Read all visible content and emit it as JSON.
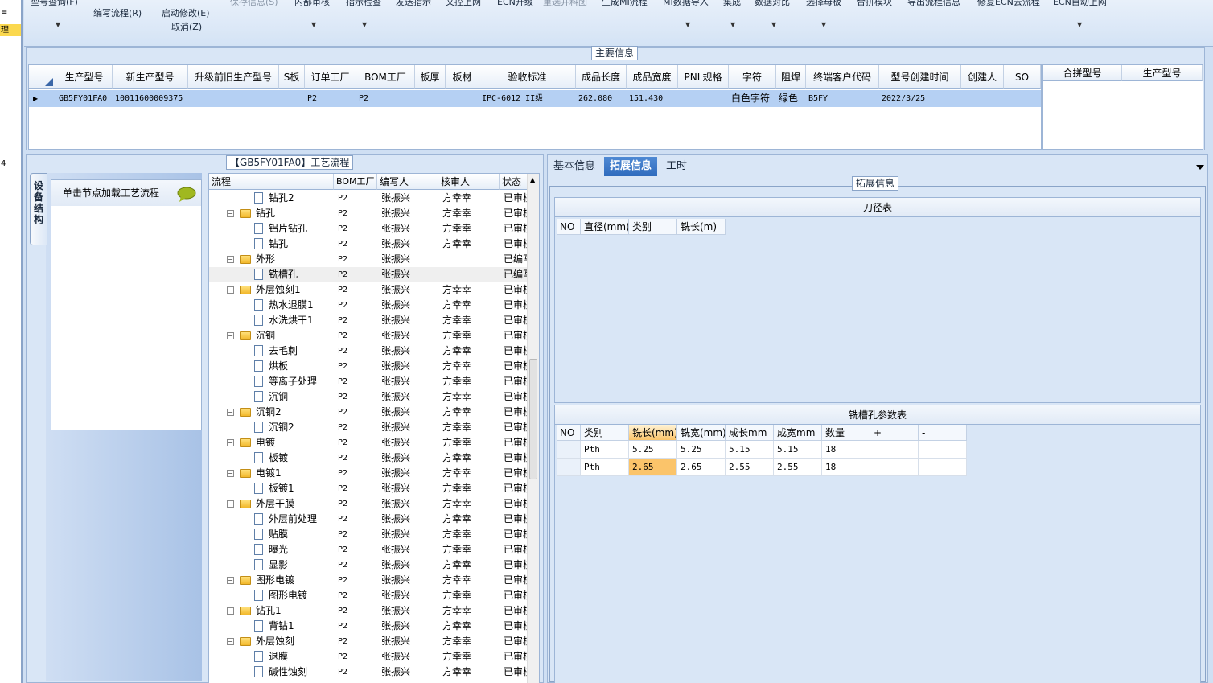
{
  "left_strip": {
    "items": [
      "≡",
      "理"
    ],
    "marker": "4"
  },
  "toolbar": {
    "row1": [
      "型号查询(F)",
      "保存信息(S)",
      "内部审核",
      "指示检查",
      "发送指示",
      "文控上网",
      "ECN升级",
      "重选并料图",
      "生成MI流程",
      "MI数据导入",
      "集成",
      "数据对比",
      "选择母板",
      "合拼模块",
      "导出流程信息",
      "修复ECN去流程",
      "ECN自动上网"
    ],
    "edit_flow": "编写流程(R)",
    "start_modify": "启动修改(E)",
    "cancel": "取消(Z)"
  },
  "main_info": {
    "title": "主要信息",
    "columns": [
      "生产型号",
      "新生产型号",
      "升级前旧生产型号",
      "S板",
      "订单工厂",
      "BOM工厂",
      "板厚",
      "板材",
      "验收标准",
      "成品长度",
      "成品宽度",
      "PNL规格",
      "字符",
      "阻焊",
      "终端客户代码",
      "型号创建时间",
      "创建人",
      "SO"
    ],
    "row": [
      "GB5FY01FA0",
      "10011600009375",
      "",
      "",
      "P2",
      "P2",
      "",
      "",
      "IPC-6012 II级",
      "262.080",
      "151.430",
      "",
      "白色字符",
      "绿色",
      "B5FY",
      "2022/3/25",
      "",
      ""
    ],
    "merge_columns": [
      "合拼型号",
      "生产型号"
    ]
  },
  "process": {
    "title": "【GB5FY01FA0】工艺流程",
    "side_tab": "设备结构",
    "load_hint": "单击节点加载工艺流程",
    "columns": [
      "流程",
      "BOM工厂",
      "编写人",
      "核审人",
      "状态"
    ],
    "rows": [
      {
        "name": "钻孔2",
        "level": 2,
        "factory": "P2",
        "writer": "张振兴",
        "reviewer": "方幸幸",
        "status": "已审核"
      },
      {
        "name": "钻孔",
        "level": 1,
        "factory": "P2",
        "writer": "张振兴",
        "reviewer": "方幸幸",
        "status": "已审核"
      },
      {
        "name": "铝片钻孔",
        "level": 2,
        "factory": "P2",
        "writer": "张振兴",
        "reviewer": "方幸幸",
        "status": "已审核"
      },
      {
        "name": "钻孔",
        "level": 2,
        "factory": "P2",
        "writer": "张振兴",
        "reviewer": "方幸幸",
        "status": "已审核"
      },
      {
        "name": "外形",
        "level": 1,
        "factory": "P2",
        "writer": "张振兴",
        "reviewer": "",
        "status": "已编写"
      },
      {
        "name": "铣槽孔",
        "level": 2,
        "factory": "P2",
        "writer": "张振兴",
        "reviewer": "",
        "status": "已编写",
        "selected": true
      },
      {
        "name": "外层蚀刻1",
        "level": 1,
        "factory": "P2",
        "writer": "张振兴",
        "reviewer": "方幸幸",
        "status": "已审核"
      },
      {
        "name": "热水退膜1",
        "level": 2,
        "factory": "P2",
        "writer": "张振兴",
        "reviewer": "方幸幸",
        "status": "已审核"
      },
      {
        "name": "水洗烘干1",
        "level": 2,
        "factory": "P2",
        "writer": "张振兴",
        "reviewer": "方幸幸",
        "status": "已审核"
      },
      {
        "name": "沉铜",
        "level": 1,
        "factory": "P2",
        "writer": "张振兴",
        "reviewer": "方幸幸",
        "status": "已审核"
      },
      {
        "name": "去毛刺",
        "level": 2,
        "factory": "P2",
        "writer": "张振兴",
        "reviewer": "方幸幸",
        "status": "已审核"
      },
      {
        "name": "烘板",
        "level": 2,
        "factory": "P2",
        "writer": "张振兴",
        "reviewer": "方幸幸",
        "status": "已审核"
      },
      {
        "name": "等离子处理",
        "level": 2,
        "factory": "P2",
        "writer": "张振兴",
        "reviewer": "方幸幸",
        "status": "已审核"
      },
      {
        "name": "沉铜",
        "level": 2,
        "factory": "P2",
        "writer": "张振兴",
        "reviewer": "方幸幸",
        "status": "已审核"
      },
      {
        "name": "沉铜2",
        "level": 1,
        "factory": "P2",
        "writer": "张振兴",
        "reviewer": "方幸幸",
        "status": "已审核"
      },
      {
        "name": "沉铜2",
        "level": 2,
        "factory": "P2",
        "writer": "张振兴",
        "reviewer": "方幸幸",
        "status": "已审核"
      },
      {
        "name": "电镀",
        "level": 1,
        "factory": "P2",
        "writer": "张振兴",
        "reviewer": "方幸幸",
        "status": "已审核"
      },
      {
        "name": "板镀",
        "level": 2,
        "factory": "P2",
        "writer": "张振兴",
        "reviewer": "方幸幸",
        "status": "已审核"
      },
      {
        "name": "电镀1",
        "level": 1,
        "factory": "P2",
        "writer": "张振兴",
        "reviewer": "方幸幸",
        "status": "已审核"
      },
      {
        "name": "板镀1",
        "level": 2,
        "factory": "P2",
        "writer": "张振兴",
        "reviewer": "方幸幸",
        "status": "已审核"
      },
      {
        "name": "外层干膜",
        "level": 1,
        "factory": "P2",
        "writer": "张振兴",
        "reviewer": "方幸幸",
        "status": "已审核"
      },
      {
        "name": "外层前处理",
        "level": 2,
        "factory": "P2",
        "writer": "张振兴",
        "reviewer": "方幸幸",
        "status": "已审核"
      },
      {
        "name": "贴膜",
        "level": 2,
        "factory": "P2",
        "writer": "张振兴",
        "reviewer": "方幸幸",
        "status": "已审核"
      },
      {
        "name": "曝光",
        "level": 2,
        "factory": "P2",
        "writer": "张振兴",
        "reviewer": "方幸幸",
        "status": "已审核"
      },
      {
        "name": "显影",
        "level": 2,
        "factory": "P2",
        "writer": "张振兴",
        "reviewer": "方幸幸",
        "status": "已审核"
      },
      {
        "name": "图形电镀",
        "level": 1,
        "factory": "P2",
        "writer": "张振兴",
        "reviewer": "方幸幸",
        "status": "已审核"
      },
      {
        "name": "图形电镀",
        "level": 2,
        "factory": "P2",
        "writer": "张振兴",
        "reviewer": "方幸幸",
        "status": "已审核"
      },
      {
        "name": "钻孔1",
        "level": 1,
        "factory": "P2",
        "writer": "张振兴",
        "reviewer": "方幸幸",
        "status": "已审核"
      },
      {
        "name": "背钻1",
        "level": 2,
        "factory": "P2",
        "writer": "张振兴",
        "reviewer": "方幸幸",
        "status": "已审核"
      },
      {
        "name": "外层蚀刻",
        "level": 1,
        "factory": "P2",
        "writer": "张振兴",
        "reviewer": "方幸幸",
        "status": "已审核"
      },
      {
        "name": "退膜",
        "level": 2,
        "factory": "P2",
        "writer": "张振兴",
        "reviewer": "方幸幸",
        "status": "已审核"
      },
      {
        "name": "碱性蚀刻",
        "level": 2,
        "factory": "P2",
        "writer": "张振兴",
        "reviewer": "方幸幸",
        "status": "已审核"
      }
    ]
  },
  "right": {
    "tabs": [
      "基本信息",
      "拓展信息",
      "工时"
    ],
    "active_tab": 1,
    "ext_title": "拓展信息",
    "cutter": {
      "title": "刀径表",
      "columns": [
        "NO",
        "直径(mm)",
        "类别",
        "铣长(m)"
      ]
    },
    "slot": {
      "title": "铣槽孔参数表",
      "columns": [
        "NO",
        "类别",
        "铣长(mm)",
        "铣宽(mm)",
        "成长mm",
        "成宽mm",
        "数量",
        "+",
        "-"
      ],
      "rows": [
        [
          "",
          "Pth",
          "5.25",
          "5.25",
          "5.15",
          "5.15",
          "18",
          "",
          ""
        ],
        [
          "",
          "Pth",
          "2.65",
          "2.65",
          "2.55",
          "2.55",
          "18",
          "",
          ""
        ]
      ]
    }
  },
  "colors": {
    "accent": "#2f6bbd",
    "selection": "#b5d0f3",
    "highlight": "#fbc46a",
    "folder": "#f2b82b"
  }
}
